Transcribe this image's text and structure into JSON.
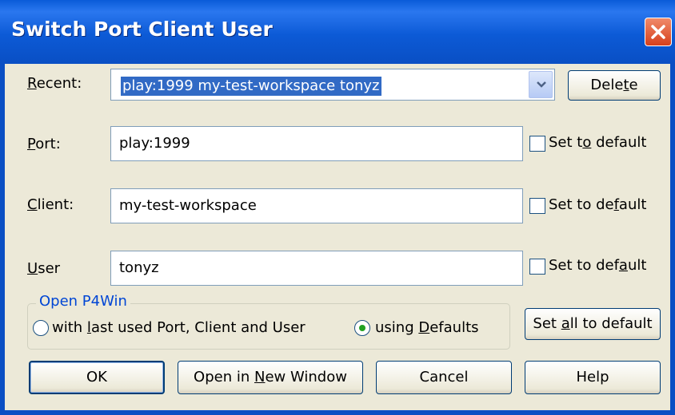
{
  "window": {
    "title": "Switch Port Client User",
    "close_icon": "close-icon"
  },
  "recent": {
    "label_accel": "R",
    "label_rest": "ecent:",
    "value": "play:1999 my-test-workspace tonyz",
    "delete_pre": "Dele",
    "delete_accel": "t",
    "delete_post": "e"
  },
  "port": {
    "label_accel": "P",
    "label_rest": "ort:",
    "value": "play:1999",
    "default_pre": "Set t",
    "default_accel": "o",
    "default_post": " default",
    "checked": false
  },
  "client": {
    "label_accel": "C",
    "label_rest": "lient:",
    "value": "my-test-workspace",
    "default_pre": "Set to de",
    "default_accel": "f",
    "default_post": "ault",
    "checked": false
  },
  "user": {
    "label_accel": "U",
    "label_rest": "ser",
    "value": "tonyz",
    "default_pre": "Set to def",
    "default_accel": "a",
    "default_post": "ult",
    "checked": false
  },
  "open_group": {
    "legend": "Open P4Win",
    "option1_pre": "with ",
    "option1_accel": "l",
    "option1_post": "ast used Port, Client and User",
    "option2_pre": "using ",
    "option2_accel": "D",
    "option2_post": "efaults",
    "selected": "using Defaults"
  },
  "buttons": {
    "set_all_pre": "Set ",
    "set_all_accel": "a",
    "set_all_post": "ll to default",
    "ok": "OK",
    "open_new_pre": "Open in ",
    "open_new_accel": "N",
    "open_new_post": "ew Window",
    "cancel": "Cancel",
    "help": "Help"
  },
  "colors": {
    "title_bar": "#0a5bd8",
    "selection": "#316ac5",
    "group_legend": "#0046d5",
    "radio_dot": "#21a121"
  }
}
